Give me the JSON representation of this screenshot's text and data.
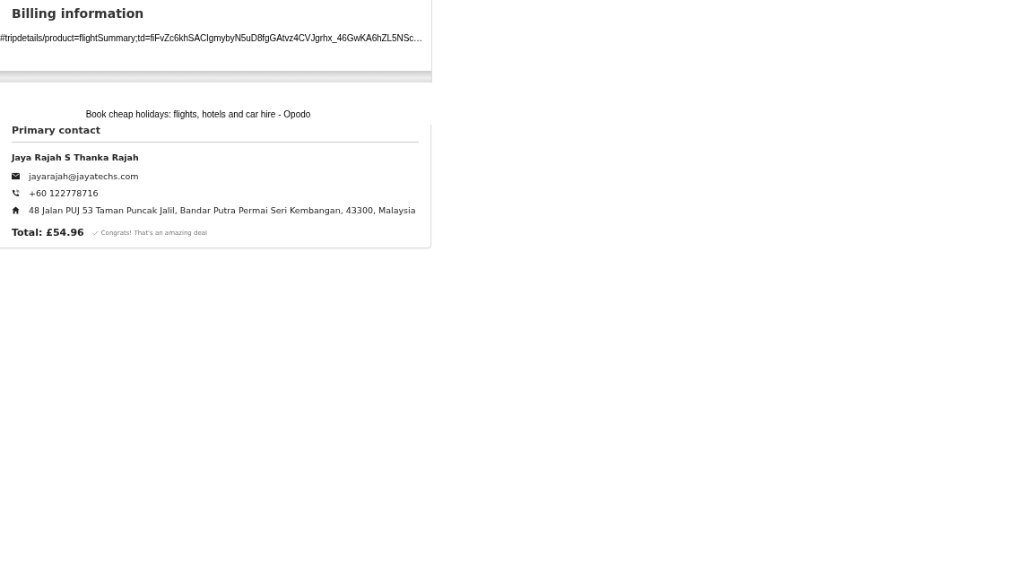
{
  "billing": {
    "title": "Billing information",
    "url": "#tripdetails/product=flightSummary;td=fiFvZc6khSACIgmybyN5uD8fgGAtvz4CVJgrhx_46GwKA6hZL5NSc…"
  },
  "page_title": "Book cheap holidays: flights, hotels and car hire - Opodo",
  "contact": {
    "heading": "Primary contact",
    "name": "Jaya Rajah S Thanka Rajah",
    "items": [
      {
        "kind": "email",
        "text": "jayarajah@jayatechs.com"
      },
      {
        "kind": "phone",
        "text": "+60 122778716"
      },
      {
        "kind": "address",
        "text": "48 Jalan PUJ 53 Taman Puncak Jalil, Bandar Putra Permai Seri Kembangan, 43300, Malaysia"
      }
    ],
    "total": "Total: £54.96",
    "note": "Congrats! That's an amazing deal"
  }
}
